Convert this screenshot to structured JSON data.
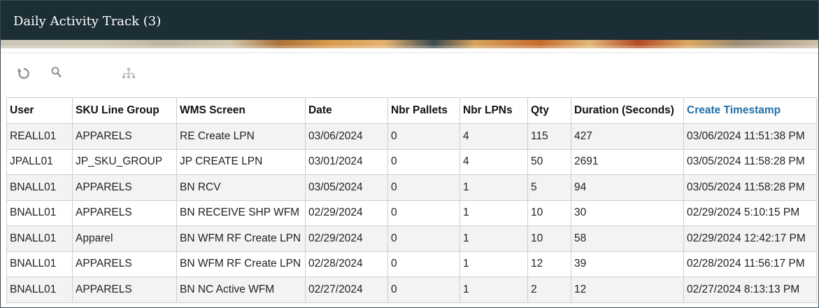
{
  "window": {
    "title": "Daily Activity Track (3)"
  },
  "toolbar": {
    "refresh_icon": "refresh-icon",
    "search_icon": "search-icon",
    "hierarchy_icon": "hierarchy-icon"
  },
  "colors": {
    "header_bg": "#1b2d35",
    "link": "#1f6fa8",
    "row_alt": "#f3f3f3"
  },
  "table": {
    "columns": [
      "User",
      "SKU Line Group",
      "WMS Screen",
      "Date",
      "Nbr Pallets",
      "Nbr LPNs",
      "Qty",
      "Duration (Seconds)",
      "Create Timestamp"
    ],
    "rows": [
      [
        "REALL01",
        "APPARELS",
        "RE Create LPN",
        "03/06/2024",
        "0",
        "4",
        "115",
        "427",
        "03/06/2024 11:51:38 PM"
      ],
      [
        "JPALL01",
        "JP_SKU_GROUP",
        "JP CREATE LPN",
        "03/01/2024",
        "0",
        "4",
        "50",
        "2691",
        "03/05/2024 11:58:28 PM"
      ],
      [
        "BNALL01",
        "APPARELS",
        "BN RCV",
        "03/05/2024",
        "0",
        "1",
        "5",
        "94",
        "03/05/2024 11:58:28 PM"
      ],
      [
        "BNALL01",
        "APPARELS",
        "BN RECEIVE SHP WFM",
        "02/29/2024",
        "0",
        "1",
        "10",
        "30",
        "02/29/2024 5:10:15 PM"
      ],
      [
        "BNALL01",
        "Apparel",
        "BN WFM RF Create LPN",
        "02/29/2024",
        "0",
        "1",
        "10",
        "58",
        "02/29/2024 12:42:17 PM"
      ],
      [
        "BNALL01",
        "APPARELS",
        "BN WFM RF Create LPN",
        "02/28/2024",
        "0",
        "1",
        "12",
        "39",
        "02/28/2024 11:56:17 PM"
      ],
      [
        "BNALL01",
        "APPARELS",
        "BN NC Active WFM",
        "02/27/2024",
        "0",
        "1",
        "2",
        "12",
        "02/27/2024 8:13:13 PM"
      ]
    ]
  }
}
